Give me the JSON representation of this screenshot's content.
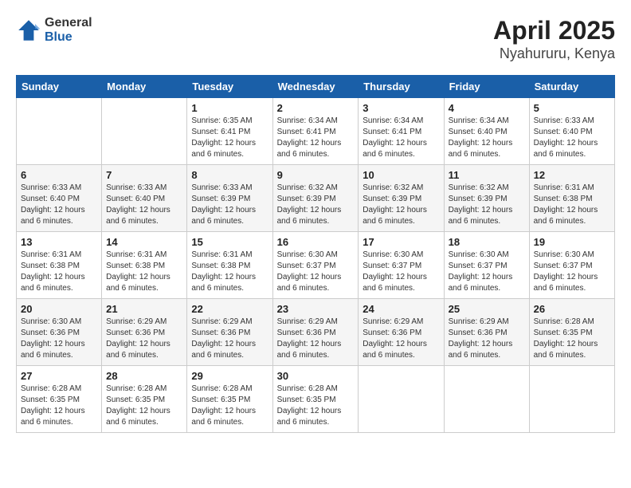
{
  "header": {
    "logo_general": "General",
    "logo_blue": "Blue",
    "title": "April 2025",
    "subtitle": "Nyahururu, Kenya"
  },
  "days_of_week": [
    "Sunday",
    "Monday",
    "Tuesday",
    "Wednesday",
    "Thursday",
    "Friday",
    "Saturday"
  ],
  "weeks": [
    [
      {
        "day": "",
        "content": ""
      },
      {
        "day": "",
        "content": ""
      },
      {
        "day": "1",
        "content": "Sunrise: 6:35 AM\nSunset: 6:41 PM\nDaylight: 12 hours and 6 minutes."
      },
      {
        "day": "2",
        "content": "Sunrise: 6:34 AM\nSunset: 6:41 PM\nDaylight: 12 hours and 6 minutes."
      },
      {
        "day": "3",
        "content": "Sunrise: 6:34 AM\nSunset: 6:41 PM\nDaylight: 12 hours and 6 minutes."
      },
      {
        "day": "4",
        "content": "Sunrise: 6:34 AM\nSunset: 6:40 PM\nDaylight: 12 hours and 6 minutes."
      },
      {
        "day": "5",
        "content": "Sunrise: 6:33 AM\nSunset: 6:40 PM\nDaylight: 12 hours and 6 minutes."
      }
    ],
    [
      {
        "day": "6",
        "content": "Sunrise: 6:33 AM\nSunset: 6:40 PM\nDaylight: 12 hours and 6 minutes."
      },
      {
        "day": "7",
        "content": "Sunrise: 6:33 AM\nSunset: 6:40 PM\nDaylight: 12 hours and 6 minutes."
      },
      {
        "day": "8",
        "content": "Sunrise: 6:33 AM\nSunset: 6:39 PM\nDaylight: 12 hours and 6 minutes."
      },
      {
        "day": "9",
        "content": "Sunrise: 6:32 AM\nSunset: 6:39 PM\nDaylight: 12 hours and 6 minutes."
      },
      {
        "day": "10",
        "content": "Sunrise: 6:32 AM\nSunset: 6:39 PM\nDaylight: 12 hours and 6 minutes."
      },
      {
        "day": "11",
        "content": "Sunrise: 6:32 AM\nSunset: 6:39 PM\nDaylight: 12 hours and 6 minutes."
      },
      {
        "day": "12",
        "content": "Sunrise: 6:31 AM\nSunset: 6:38 PM\nDaylight: 12 hours and 6 minutes."
      }
    ],
    [
      {
        "day": "13",
        "content": "Sunrise: 6:31 AM\nSunset: 6:38 PM\nDaylight: 12 hours and 6 minutes."
      },
      {
        "day": "14",
        "content": "Sunrise: 6:31 AM\nSunset: 6:38 PM\nDaylight: 12 hours and 6 minutes."
      },
      {
        "day": "15",
        "content": "Sunrise: 6:31 AM\nSunset: 6:38 PM\nDaylight: 12 hours and 6 minutes."
      },
      {
        "day": "16",
        "content": "Sunrise: 6:30 AM\nSunset: 6:37 PM\nDaylight: 12 hours and 6 minutes."
      },
      {
        "day": "17",
        "content": "Sunrise: 6:30 AM\nSunset: 6:37 PM\nDaylight: 12 hours and 6 minutes."
      },
      {
        "day": "18",
        "content": "Sunrise: 6:30 AM\nSunset: 6:37 PM\nDaylight: 12 hours and 6 minutes."
      },
      {
        "day": "19",
        "content": "Sunrise: 6:30 AM\nSunset: 6:37 PM\nDaylight: 12 hours and 6 minutes."
      }
    ],
    [
      {
        "day": "20",
        "content": "Sunrise: 6:30 AM\nSunset: 6:36 PM\nDaylight: 12 hours and 6 minutes."
      },
      {
        "day": "21",
        "content": "Sunrise: 6:29 AM\nSunset: 6:36 PM\nDaylight: 12 hours and 6 minutes."
      },
      {
        "day": "22",
        "content": "Sunrise: 6:29 AM\nSunset: 6:36 PM\nDaylight: 12 hours and 6 minutes."
      },
      {
        "day": "23",
        "content": "Sunrise: 6:29 AM\nSunset: 6:36 PM\nDaylight: 12 hours and 6 minutes."
      },
      {
        "day": "24",
        "content": "Sunrise: 6:29 AM\nSunset: 6:36 PM\nDaylight: 12 hours and 6 minutes."
      },
      {
        "day": "25",
        "content": "Sunrise: 6:29 AM\nSunset: 6:36 PM\nDaylight: 12 hours and 6 minutes."
      },
      {
        "day": "26",
        "content": "Sunrise: 6:28 AM\nSunset: 6:35 PM\nDaylight: 12 hours and 6 minutes."
      }
    ],
    [
      {
        "day": "27",
        "content": "Sunrise: 6:28 AM\nSunset: 6:35 PM\nDaylight: 12 hours and 6 minutes."
      },
      {
        "day": "28",
        "content": "Sunrise: 6:28 AM\nSunset: 6:35 PM\nDaylight: 12 hours and 6 minutes."
      },
      {
        "day": "29",
        "content": "Sunrise: 6:28 AM\nSunset: 6:35 PM\nDaylight: 12 hours and 6 minutes."
      },
      {
        "day": "30",
        "content": "Sunrise: 6:28 AM\nSunset: 6:35 PM\nDaylight: 12 hours and 6 minutes."
      },
      {
        "day": "",
        "content": ""
      },
      {
        "day": "",
        "content": ""
      },
      {
        "day": "",
        "content": ""
      }
    ]
  ]
}
